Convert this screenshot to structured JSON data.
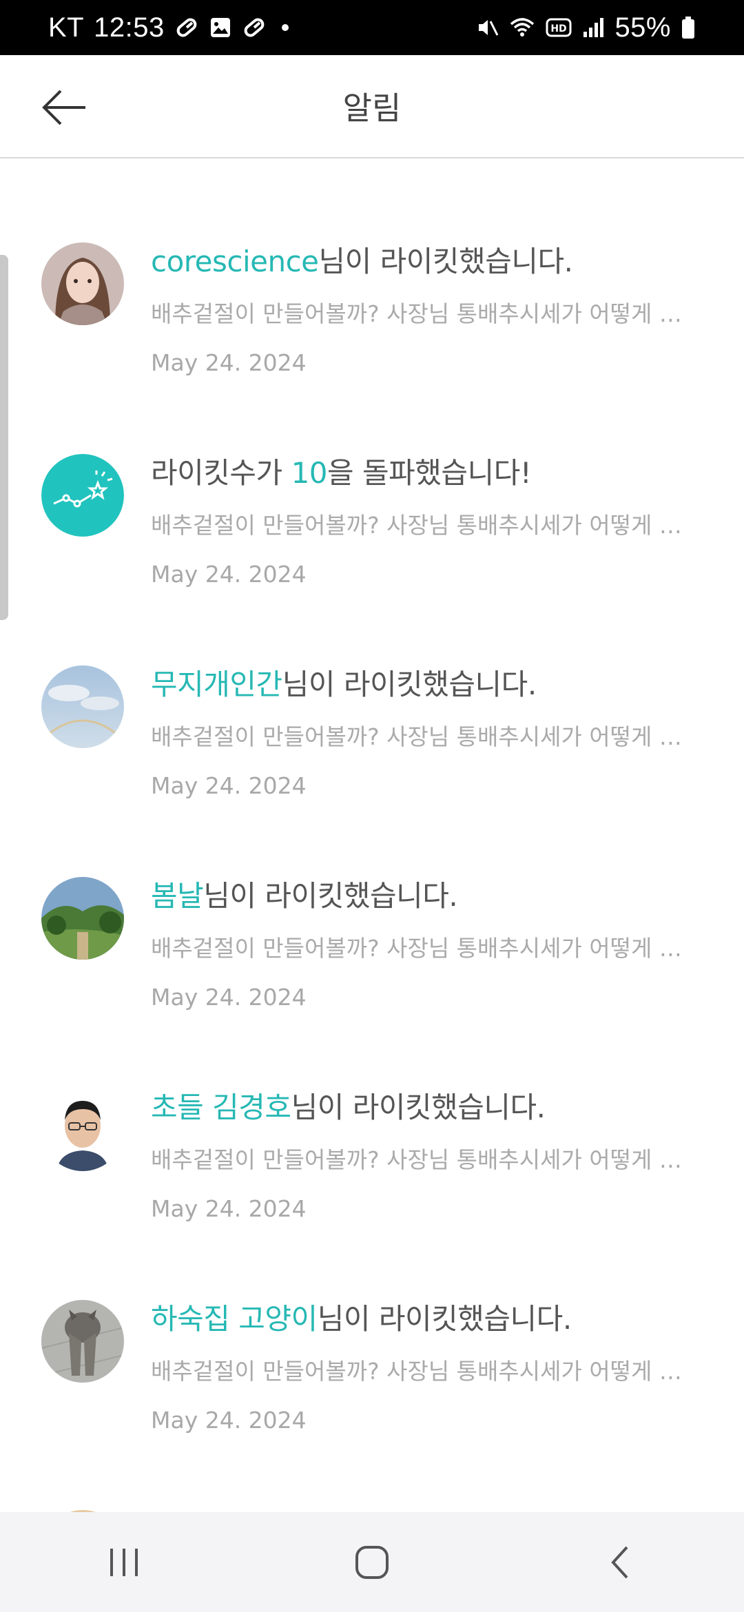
{
  "status_bar": {
    "carrier": "KT",
    "time": "12:53",
    "battery": "55%",
    "icons": [
      "pill-icon",
      "image-icon",
      "pill-icon",
      "mute-icon",
      "wifi-icon",
      "hd-icon",
      "signal-icon",
      "battery-icon"
    ]
  },
  "header": {
    "title": "알림",
    "back_icon": "arrow-left-icon"
  },
  "notifications": [
    {
      "highlight": "corescience",
      "suffix": "님이 라이킷했습니다.",
      "preview": "배추겉절이 만들어볼까? 사장님 통배추시세가 어떻게 되나요?",
      "date": "May 24. 2024",
      "avatar": "user-avatar-woman"
    },
    {
      "prefix": "라이킷수가 ",
      "highlight": "10",
      "suffix": "을 돌파했습니다!",
      "preview": "배추겉절이 만들어볼까? 사장님 통배추시세가 어떻게 되나요?",
      "date": "May 24. 2024",
      "avatar": "milestone-icon"
    },
    {
      "highlight": "무지개인간",
      "suffix": "님이 라이킷했습니다.",
      "preview": "배추겉절이 만들어볼까? 사장님 통배추시세가 어떻게 되나요?",
      "date": "May 24. 2024",
      "avatar": "user-avatar-sky"
    },
    {
      "highlight": "봄날",
      "suffix": "님이 라이킷했습니다.",
      "preview": "배추겉절이 만들어볼까? 사장님 통배추시세가 어떻게 되나요?",
      "date": "May 24. 2024",
      "avatar": "user-avatar-garden"
    },
    {
      "highlight": "초들 김경호",
      "suffix": "님이 라이킷했습니다.",
      "preview": "배추겉절이 만들어볼까? 사장님 통배추시세가 어떻게 되나요?",
      "date": "May 24. 2024",
      "avatar": "user-avatar-man"
    },
    {
      "highlight": "하숙집 고양이",
      "suffix": "님이 라이킷했습니다.",
      "preview": "배추겉절이 만들어볼까? 사장님 통배추시세가 어떻게 되나요?",
      "date": "May 24. 2024",
      "avatar": "user-avatar-cat"
    }
  ],
  "nav_bar": {
    "recent_icon": "recent-apps-icon",
    "home_icon": "home-icon",
    "back_icon": "back-icon"
  },
  "colors": {
    "accent": "#26b8b4",
    "title_text": "#555555",
    "muted_text": "#aaaaaa"
  }
}
